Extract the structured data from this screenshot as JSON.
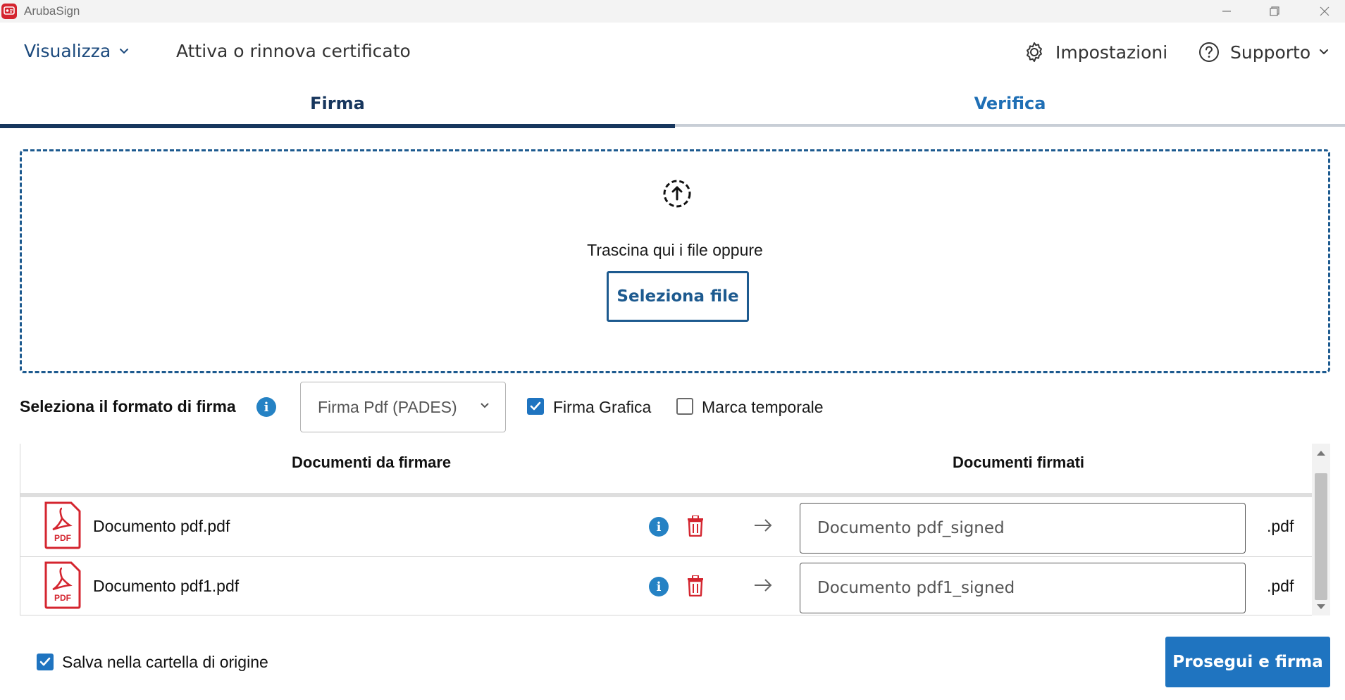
{
  "window": {
    "title": "ArubaSign",
    "logo_icon": "arubasign-logo-icon",
    "controls": [
      "minimize-icon",
      "restore-icon",
      "close-icon"
    ]
  },
  "menu": {
    "view": "Visualizza",
    "certificate": "Attiva o rinnova certificato",
    "settings": "Impostazioni",
    "support": "Supporto"
  },
  "tabs": {
    "sign": "Firma",
    "verify": "Verifica",
    "active": "Firma"
  },
  "dropzone": {
    "text": "Trascina qui i file oppure",
    "button": "Seleziona file",
    "icon": "upload-icon"
  },
  "format": {
    "label": "Seleziona il formato di firma",
    "selected": "Firma Pdf (PADES)",
    "graphic_signature": "Firma Grafica",
    "graphic_signature_checked": true,
    "timestamp": "Marca temporale",
    "timestamp_checked": false
  },
  "table": {
    "col_to_sign": "Documenti da firmare",
    "col_signed": "Documenti firmati",
    "rows": [
      {
        "name": "Documento pdf.pdf",
        "output": "Documento pdf_signed",
        "ext": ".pdf"
      },
      {
        "name": "Documento pdf1.pdf",
        "output": "Documento pdf1_signed",
        "ext": ".pdf"
      }
    ],
    "pdf_badge": "PDF"
  },
  "footer": {
    "save_in_origin": "Salva nella cartella di origine",
    "save_in_origin_checked": true,
    "proceed": "Prosegui e firma"
  },
  "colors": {
    "primary": "#1f74c0",
    "navy": "#17365d",
    "link": "#1f6fb5",
    "danger": "#d4252f",
    "info": "#2582c4"
  }
}
